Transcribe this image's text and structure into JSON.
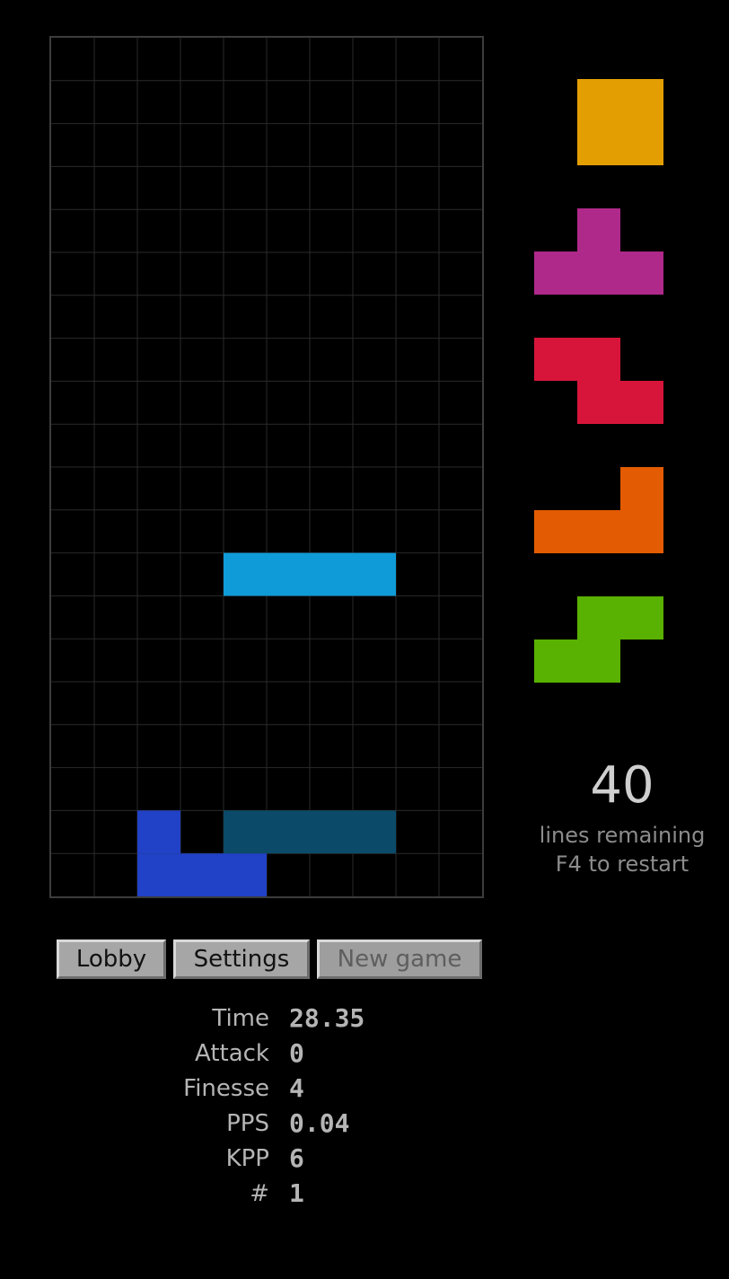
{
  "board": {
    "columns": 10,
    "rows": 20,
    "cells": [
      {
        "col": 4,
        "row": 12,
        "piece": "I-falling"
      },
      {
        "col": 5,
        "row": 12,
        "piece": "I-falling"
      },
      {
        "col": 6,
        "row": 12,
        "piece": "I-falling"
      },
      {
        "col": 7,
        "row": 12,
        "piece": "I-falling"
      },
      {
        "col": 2,
        "row": 18,
        "piece": "J"
      },
      {
        "col": 4,
        "row": 18,
        "piece": "I-ghost"
      },
      {
        "col": 5,
        "row": 18,
        "piece": "I-ghost"
      },
      {
        "col": 6,
        "row": 18,
        "piece": "I-ghost"
      },
      {
        "col": 7,
        "row": 18,
        "piece": "I-ghost"
      },
      {
        "col": 2,
        "row": 19,
        "piece": "J"
      },
      {
        "col": 3,
        "row": 19,
        "piece": "J"
      },
      {
        "col": 4,
        "row": 19,
        "piece": "J"
      }
    ]
  },
  "colors": {
    "I-falling": "#0f9bd7",
    "I-ghost": "#0b4a68",
    "J": "#2141c6",
    "O": "#e39f02",
    "T": "#af298a",
    "Z": "#d7153a",
    "L": "#e35b02",
    "S": "#59b101",
    "grid": "#2a2a2a"
  },
  "queue": [
    {
      "piece": "O",
      "cells": [
        [
          1,
          0
        ],
        [
          2,
          0
        ],
        [
          1,
          1
        ],
        [
          2,
          1
        ]
      ]
    },
    {
      "piece": "T",
      "cells": [
        [
          1,
          0
        ],
        [
          0,
          1
        ],
        [
          1,
          1
        ],
        [
          2,
          1
        ]
      ]
    },
    {
      "piece": "Z",
      "cells": [
        [
          0,
          0
        ],
        [
          1,
          0
        ],
        [
          1,
          1
        ],
        [
          2,
          1
        ]
      ]
    },
    {
      "piece": "L",
      "cells": [
        [
          2,
          0
        ],
        [
          0,
          1
        ],
        [
          1,
          1
        ],
        [
          2,
          1
        ]
      ]
    },
    {
      "piece": "S",
      "cells": [
        [
          1,
          0
        ],
        [
          2,
          0
        ],
        [
          0,
          1
        ],
        [
          1,
          1
        ]
      ]
    }
  ],
  "lines": {
    "count": "40",
    "label": "lines remaining",
    "restart_hint": "F4 to restart"
  },
  "buttons": {
    "lobby": "Lobby",
    "settings": "Settings",
    "new_game": "New game"
  },
  "stats": [
    {
      "label": "Time",
      "value": "28.35"
    },
    {
      "label": "Attack",
      "value": "0"
    },
    {
      "label": "Finesse",
      "value": "4"
    },
    {
      "label": "PPS",
      "value": "0.04"
    },
    {
      "label": "KPP",
      "value": "6"
    },
    {
      "label": "#",
      "value": "1"
    }
  ]
}
